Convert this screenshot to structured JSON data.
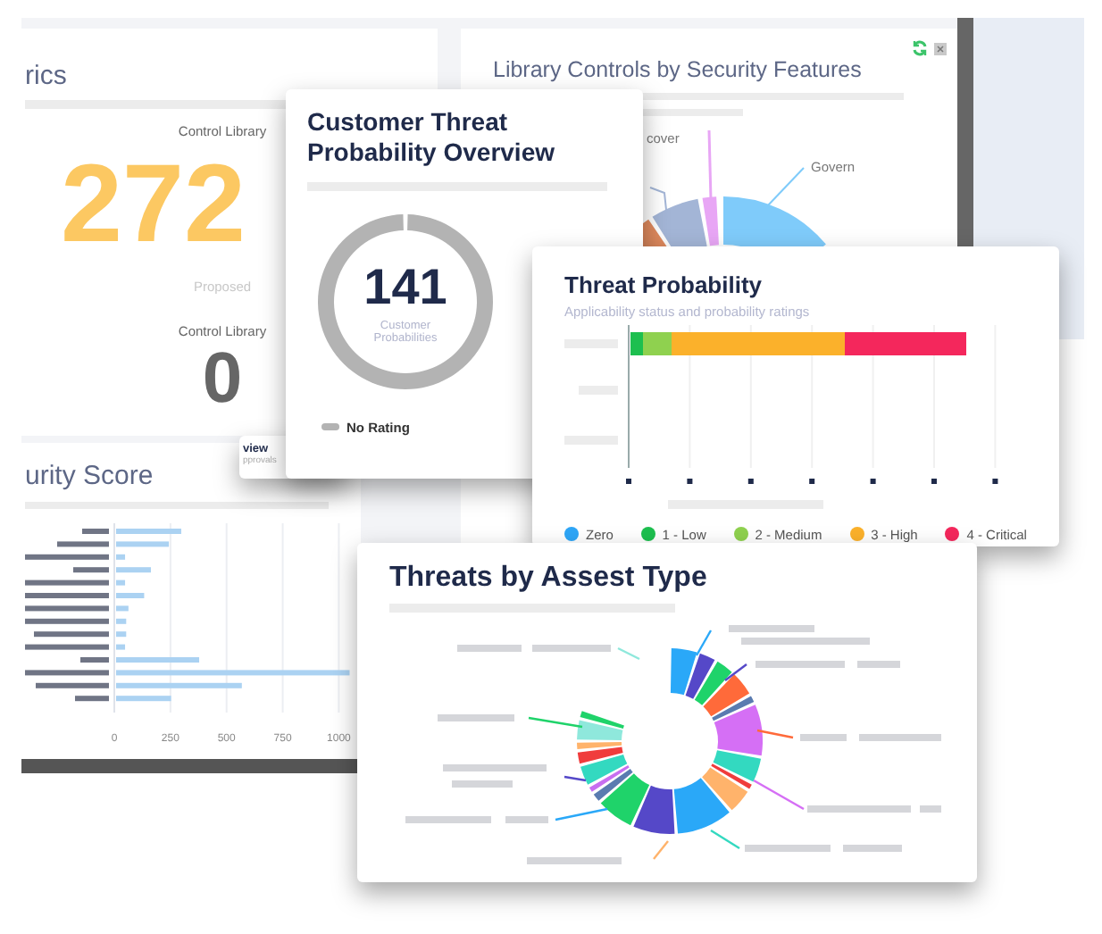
{
  "metrics_card": {
    "title": "rics",
    "stats": [
      {
        "kind": "proposed",
        "label": "Control Library",
        "value": "272",
        "caption": "Proposed"
      },
      {
        "kind": "zero",
        "label": "Control Library",
        "value": "0"
      }
    ]
  },
  "library_card": {
    "title": "Library Controls by Security Features",
    "chart_labels": [
      "cover",
      "Govern"
    ]
  },
  "hidden_card": {
    "title": "view",
    "subtitle": "pprovals"
  },
  "security_card": {
    "title": "urity Score",
    "chart_data": {
      "type": "bar",
      "orientation": "horizontal",
      "grid": true,
      "xlim": [
        0,
        1050
      ],
      "xticks": [
        0,
        250,
        500,
        750,
        1000
      ],
      "values": [
        290,
        235,
        40,
        155,
        40,
        125,
        55,
        45,
        45,
        40,
        370,
        1040,
        560,
        245
      ]
    }
  },
  "customer_card": {
    "title": "Customer Threat Probability Overview",
    "total": "141",
    "total_label": "Customer Probabilities",
    "legend": [
      {
        "label": "No Rating",
        "color": "#b3b3b3"
      }
    ]
  },
  "threat_probability_card": {
    "title": "Threat Probability",
    "subtitle": "Applicability status and probability ratings",
    "legend": [
      {
        "label": "Zero",
        "color": "#2ea6f7"
      },
      {
        "label": "1 - Low",
        "color": "#1dbf4f"
      },
      {
        "label": "2 - Medium",
        "color": "#8fd14f"
      },
      {
        "label": "3 - High",
        "color": "#fbb12b"
      },
      {
        "label": "4 - Critical",
        "color": "#f4275c"
      }
    ]
  },
  "threats_card": {
    "title": "Threats by Assest Type"
  }
}
